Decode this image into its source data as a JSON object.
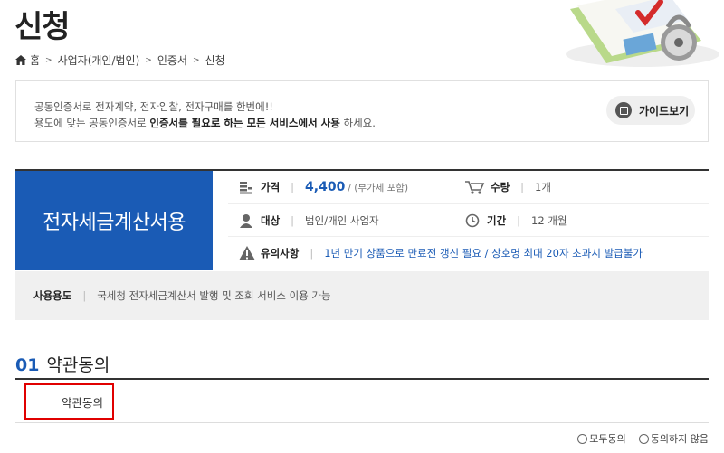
{
  "page_title": "신청",
  "breadcrumb": [
    "홈",
    "사업자(개인/법인)",
    "인증서",
    "신청"
  ],
  "intro": {
    "line1": "공동인증서로 전자계약, 전자입찰, 전자구매를 한번에!!",
    "line2_pre": "용도에 맞는 공동인증서로 ",
    "line2_bold": "인증서를 필요로 하는 모든 서비스에서 사용",
    "line2_post": " 하세요.",
    "guide_button": "가이드보기"
  },
  "product": {
    "name": "전자세금계산서용",
    "price_label": "가격",
    "price_value": "4,400",
    "price_note": "/ (부가세 포함)",
    "qty_label": "수량",
    "qty_value": "1개",
    "target_label": "대상",
    "target_value": "법인/개인 사업자",
    "period_label": "기간",
    "period_value": "12 개월",
    "notice_label": "유의사항",
    "notice_value": "1년 만기 상품으로 만료전 갱신 필요 / 상호명 최대 20자 초과시 발급불가",
    "usage_label": "사용용도",
    "usage_value": "국세청 전자세금계산서 발행 및 조회 서비스 이용 가능"
  },
  "terms": {
    "section_num": "01",
    "section_title": "약관동의",
    "checkbox_label": "약관동의",
    "agree_all": "모두동의",
    "disagree": "동의하지 않음"
  },
  "colors": {
    "accent": "#1a5bb5",
    "highlight_border": "#e00000"
  }
}
